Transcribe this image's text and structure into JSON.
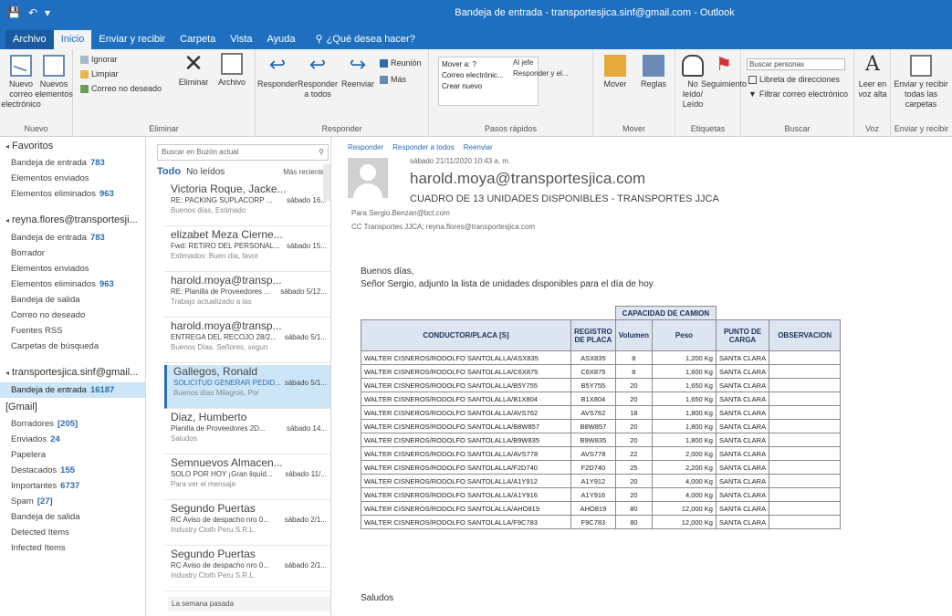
{
  "window": {
    "title": "Bandeja de entrada - transportesjica.sinf@gmail.com - Outlook",
    "quick_access": [
      "save-icon",
      "undo-icon",
      "qat-dropdown-icon"
    ]
  },
  "tabs": [
    {
      "label": "Archivo"
    },
    {
      "label": "Inicio"
    },
    {
      "label": "Enviar y recibir"
    },
    {
      "label": "Carpeta"
    },
    {
      "label": "Vista"
    },
    {
      "label": "Ayuda"
    }
  ],
  "tell_me": "¿Qué desea hacer?",
  "ribbon": {
    "new": {
      "new_email": "Nuevo correo electrónico",
      "new_items": "Nuevos elementos",
      "group": "Nuevo"
    },
    "delete": {
      "ignore": "Ignorar",
      "clean": "Limpiar",
      "junk": "Correo no deseado",
      "delete": "Eliminar",
      "archive": "Archivo",
      "group": "Eliminar"
    },
    "respond": {
      "reply": "Responder",
      "reply_all": "Responder a todos",
      "forward": "Reenviar",
      "meeting": "Reunión",
      "more": "Más",
      "group": "Responder"
    },
    "quick_steps": {
      "items": [
        "Mover a: ?",
        "Correo electrónic...",
        "Crear nuevo",
        "Al jefe",
        "Responder y el..."
      ],
      "group": "Pasos rápidos"
    },
    "move": {
      "move": "Mover",
      "rules": "Reglas",
      "group": "Mover"
    },
    "tags": {
      "unread": "No leído/ Leído",
      "followup": "Seguimiento",
      "group": "Etiquetas"
    },
    "find": {
      "search_people": "Buscar personas",
      "address_book": "Libreta de direcciones",
      "filter": "Filtrar correo electrónico",
      "group": "Buscar"
    },
    "speech": {
      "read_aloud": "Leer en voz alta",
      "group": "Voz"
    },
    "send_all": {
      "label": "Enviar y recibir todas las carpetas",
      "group": "Enviar y recibir"
    }
  },
  "folders": {
    "favorites_label": "Favoritos",
    "favorites": [
      {
        "name": "Bandeja de entrada",
        "count": "783"
      },
      {
        "name": "Elementos enviados",
        "count": ""
      },
      {
        "name": "Elementos eliminados",
        "count": "963"
      }
    ],
    "account1": "reyna.flores@transportesji...",
    "account1_folders": [
      {
        "name": "Bandeja de entrada",
        "count": "783"
      },
      {
        "name": "Borrador",
        "count": ""
      },
      {
        "name": "Elementos enviados",
        "count": ""
      },
      {
        "name": "Elementos eliminados",
        "count": "963"
      },
      {
        "name": "Bandeja de salida",
        "count": ""
      },
      {
        "name": "Correo no deseado",
        "count": ""
      },
      {
        "name": "Fuentes RSS",
        "count": ""
      },
      {
        "name": "Carpetas de búsqueda",
        "count": ""
      }
    ],
    "account2": "transportesjica.sinf@gmail...",
    "account2_folders": [
      {
        "name": "Bandeja de entrada",
        "count": "16187",
        "selected": true
      },
      {
        "name": "[Gmail]",
        "count": "",
        "head": true
      },
      {
        "name": "Borradores",
        "count": "[205]"
      },
      {
        "name": "Enviados",
        "count": "24"
      },
      {
        "name": "Papelera",
        "count": ""
      },
      {
        "name": "Destacados",
        "count": "155"
      },
      {
        "name": "Importantes",
        "count": "6737"
      },
      {
        "name": "Spam",
        "count": "[27]"
      },
      {
        "name": "Bandeja de salida",
        "count": ""
      },
      {
        "name": "Detected Items",
        "count": ""
      },
      {
        "name": "Infected Items",
        "count": ""
      }
    ]
  },
  "list": {
    "search_placeholder": "Buscar en Buzón actual",
    "scope": "Buzón actual",
    "filter_all": "Todo",
    "filter_unread": "No leídos",
    "sort": "Más recientes",
    "messages": [
      {
        "from": "Victoria Roque, Jacke...",
        "subject": "RE: PACKING SUPLACORP ...",
        "date": "sábado 16...",
        "preview": "Buenos días, Estimado"
      },
      {
        "from": "elizabet Meza Cierne...",
        "subject": "Fwd: RETIRO DEL PERSONAL...",
        "date": "sábado 15...",
        "preview": "Estimados: Buen día, favor"
      },
      {
        "from": "harold.moya@transp...",
        "subject": "RE: Planilla de Proveedores ...",
        "date": "sábado 5/12...",
        "preview": "Trabajo actualizado a las"
      },
      {
        "from": "harold.moya@transp...",
        "subject": "ENTREGA DEL RECOJO 28/2...",
        "date": "sábado 5/1...",
        "preview": "Buenos Días. Señores, segun"
      },
      {
        "from": "Gallegos, Ronald",
        "subject": "SOLICITUD GENERAR PEDID...",
        "date": "sábado 5/1...",
        "preview": "Buenos días Milagros, Por",
        "selected": true
      },
      {
        "from": "Diaz, Humberto",
        "subject": "Planilla de Proveedores 2D...",
        "date": "sábado 14...",
        "preview": "Saludos"
      },
      {
        "from": "Semnuevos Almacen...",
        "subject": "SOLO POR HOY ¡Gran liquid...",
        "date": "sábado 11/...",
        "preview": "Para ver el mensaje"
      },
      {
        "from": "Segundo Puertas",
        "subject": "RC Aviso de despacho nro 0...",
        "date": "sábado 2/1...",
        "preview": "Industry Cloth Peru S.R.L."
      },
      {
        "from": "Segundo Puertas",
        "subject": "RC Aviso de despacho nro 0...",
        "date": "sábado 2/1...",
        "preview": "Industry Cloth Peru S.R.L."
      }
    ],
    "group_label": "La semana pasada"
  },
  "reading": {
    "actions": {
      "reply": "Responder",
      "reply_all": "Responder a todos",
      "forward": "Reenviar"
    },
    "date": "sábado 21/11/2020 10:43 a. m.",
    "sender": "harold.moya@transportesjica.com",
    "subject": "CUADRO DE 13 UNIDADES DISPONIBLES - TRANSPORTES JJCA",
    "to": "Para    Sergio.Benzan@bct.com",
    "cc": "CC    Transportes JJCA; reyna.flores@transportesjica.com",
    "greeting": "Buenos días,",
    "intro": "Señor Sergio, adjunto la lista de unidades disponibles para el día de hoy",
    "signoff": "Saludos",
    "table": {
      "cap_header": "CAPACIDAD DE CAMION",
      "headers": {
        "driver": "CONDUCTOR/PLACA [S]",
        "plate": "REGISTRO DE PLACA",
        "volume": "Volumen",
        "weight": "Peso",
        "load_point": "PUNTO DE CARGA",
        "obs": "OBSERVACION"
      },
      "rows": [
        {
          "driver": "WALTER CISNEROS/RODOLFO SANTOLALLA/ASX835",
          "plate": "ASX835",
          "volume": "8",
          "weight": "1,200 Kg",
          "point": "SANTA CLARA",
          "obs": ""
        },
        {
          "driver": "WALTER CISNEROS/RODOLFO SANTOLALLA/C6X875",
          "plate": "C6X875",
          "volume": "8",
          "weight": "1,600 Kg",
          "point": "SANTA CLARA",
          "obs": ""
        },
        {
          "driver": "WALTER CISNEROS/RODOLFO SANTOLALLA/B5Y755",
          "plate": "B5Y755",
          "volume": "20",
          "weight": "1,650 Kg",
          "point": "SANTA CLARA",
          "obs": ""
        },
        {
          "driver": "WALTER CISNEROS/RODOLFO SANTOLALLA/B1X804",
          "plate": "B1X804",
          "volume": "20",
          "weight": "1,650 Kg",
          "point": "SANTA CLARA",
          "obs": ""
        },
        {
          "driver": "WALTER CISNEROS/RODOLFO SANTOLALLA/AVS762",
          "plate": "AVS762",
          "volume": "18",
          "weight": "1,800 Kg",
          "point": "SANTA CLARA",
          "obs": ""
        },
        {
          "driver": "WALTER CISNEROS/RODOLFO SANTOLALLA/B8W857",
          "plate": "B8W857",
          "volume": "20",
          "weight": "1,800 Kg",
          "point": "SANTA CLARA",
          "obs": ""
        },
        {
          "driver": "WALTER CISNEROS/RODOLFO SANTOLALLA/B9W835",
          "plate": "B9W835",
          "volume": "20",
          "weight": "1,800 Kg",
          "point": "SANTA CLARA",
          "obs": ""
        },
        {
          "driver": "WALTER CISNEROS/RODOLFO SANTOLALLA/AVS778",
          "plate": "AVS778",
          "volume": "22",
          "weight": "2,000 Kg",
          "point": "SANTA CLARA",
          "obs": ""
        },
        {
          "driver": "WALTER CISNEROS/RODOLFO SANTOLALLA/F2D740",
          "plate": "F2D740",
          "volume": "25",
          "weight": "2,200 Kg",
          "point": "SANTA CLARA",
          "obs": ""
        },
        {
          "driver": "WALTER CISNEROS/RODOLFO SANTOLALLA/A1Y912",
          "plate": "A1Y912",
          "volume": "20",
          "weight": "4,000 Kg",
          "point": "SANTA CLARA",
          "obs": ""
        },
        {
          "driver": "WALTER CISNEROS/RODOLFO SANTOLALLA/A1Y916",
          "plate": "A1Y916",
          "volume": "20",
          "weight": "4,000 Kg",
          "point": "SANTA CLARA",
          "obs": ""
        },
        {
          "driver": "WALTER CISNEROS/RODOLFO SANTOLALLA/AHO819",
          "plate": "AHO819",
          "volume": "80",
          "weight": "12,000 Kg",
          "point": "SANTA CLARA",
          "obs": ""
        },
        {
          "driver": "WALTER CISNEROS/RODOLFO SANTOLALLA/F9C783",
          "plate": "F9C783",
          "volume": "80",
          "weight": "12,000 Kg",
          "point": "SANTA CLARA",
          "obs": ""
        }
      ]
    }
  },
  "colors": {
    "accent": "#1f6fc1",
    "selected_bg": "#cde6f7",
    "link": "#2b6cb0",
    "table_header": "#dde5f3"
  }
}
